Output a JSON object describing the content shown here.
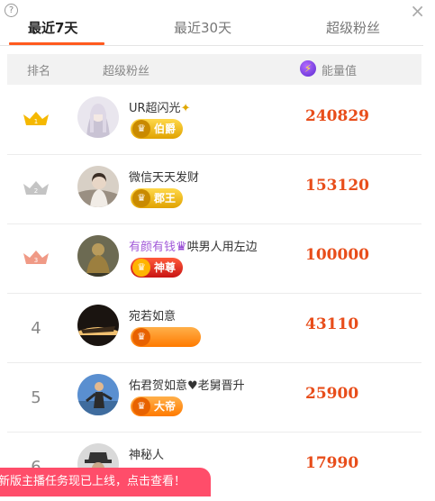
{
  "help_icon": "?",
  "close_icon": "×",
  "tabs": [
    "最近7天",
    "最近30天",
    "超级粉丝"
  ],
  "header": {
    "rank": "排名",
    "fans": "超级粉丝",
    "energy": "能量值",
    "energy_icon": "⚡"
  },
  "rows": [
    {
      "rank": "1",
      "name": "UR超闪光",
      "name_highlight": "",
      "name_suffix": "",
      "badge": "伯爵",
      "badge_style": "gold",
      "energy": "240829"
    },
    {
      "rank": "2",
      "name": "微信天天发财",
      "name_highlight": "",
      "name_suffix": "",
      "badge": "郡王",
      "badge_style": "gold",
      "energy": "153120"
    },
    {
      "rank": "3",
      "name": "",
      "name_highlight": "有颜有钱",
      "name_suffix": "哄男人用左边",
      "badge": "神尊",
      "badge_style": "red",
      "energy": "100000"
    },
    {
      "rank": "4",
      "name": "宛若如意",
      "name_highlight": "",
      "name_suffix": "",
      "badge": "",
      "badge_style": "orange",
      "energy": "43110"
    },
    {
      "rank": "5",
      "name": "佑君贺如意♥老舅晋升",
      "name_highlight": "",
      "name_suffix": "",
      "badge": "大帝",
      "badge_style": "orange",
      "energy": "25900"
    },
    {
      "rank": "6",
      "name": "神秘人",
      "name_highlight": "",
      "name_suffix": "",
      "badge": "",
      "badge_style": "",
      "energy": "17990"
    }
  ],
  "toast": "新版主播任务现已上线，点击查看！",
  "colors": {
    "accent": "#ff5a1f",
    "energy": "#e84d1a",
    "toast": "#ff4d6a"
  }
}
